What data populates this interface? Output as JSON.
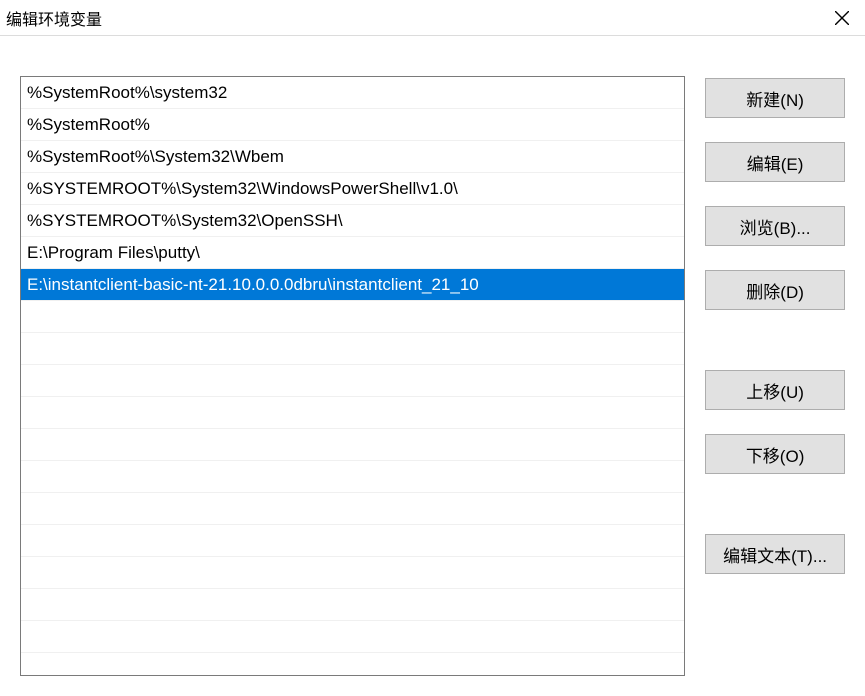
{
  "titlebar": {
    "title": "编辑环境变量"
  },
  "list": {
    "items": [
      "%SystemRoot%\\system32",
      "%SystemRoot%",
      "%SystemRoot%\\System32\\Wbem",
      "%SYSTEMROOT%\\System32\\WindowsPowerShell\\v1.0\\",
      "%SYSTEMROOT%\\System32\\OpenSSH\\",
      "E:\\Program Files\\putty\\",
      "E:\\instantclient-basic-nt-21.10.0.0.0dbru\\instantclient_21_10"
    ],
    "selectedIndex": 6
  },
  "buttons": {
    "new": "新建(N)",
    "edit": "编辑(E)",
    "browse": "浏览(B)...",
    "delete": "删除(D)",
    "moveUp": "上移(U)",
    "moveDown": "下移(O)",
    "editText": "编辑文本(T)..."
  }
}
